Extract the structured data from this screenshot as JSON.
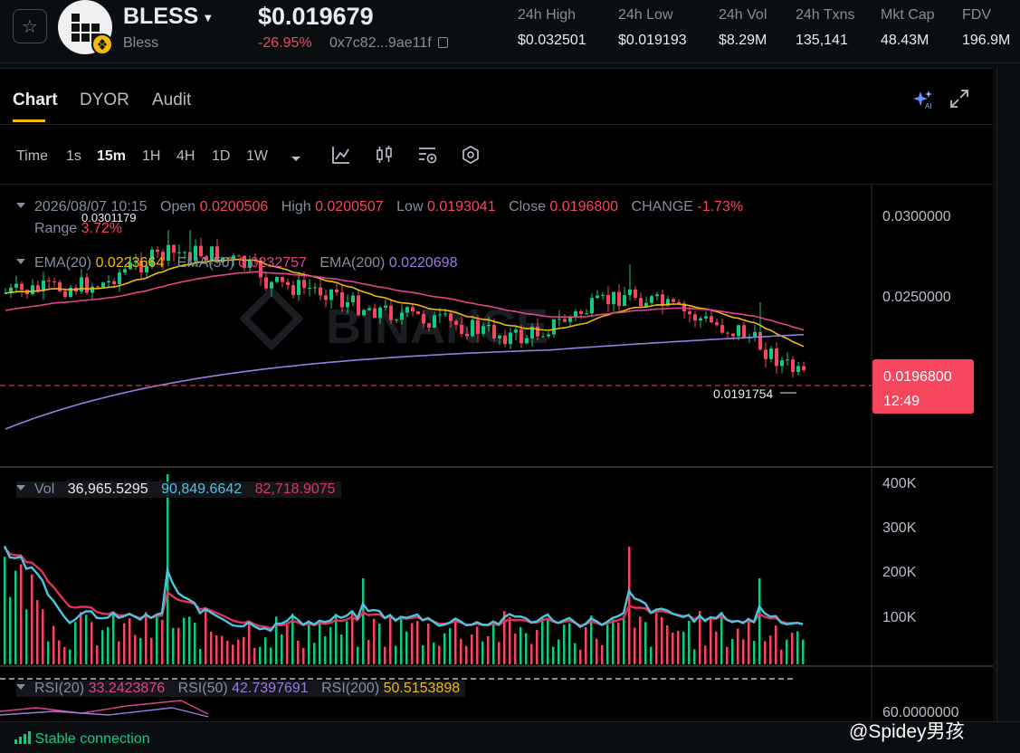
{
  "token": {
    "symbol": "BLESS",
    "name": "Bless",
    "price": "$0.019679",
    "change": "-26.95%",
    "address": "0x7c82...9ae11f"
  },
  "stats": [
    {
      "label": "24h High",
      "value": "$0.032501"
    },
    {
      "label": "24h Low",
      "value": "$0.019193"
    },
    {
      "label": "24h Vol",
      "value": "$8.29M"
    },
    {
      "label": "24h Txns",
      "value": "135,141"
    },
    {
      "label": "Mkt Cap",
      "value": "48.43M"
    },
    {
      "label": "FDV",
      "value": "196.9M"
    }
  ],
  "tabs": [
    "Chart",
    "DYOR",
    "Audit"
  ],
  "timeframes": [
    "Time",
    "1s",
    "15m",
    "1H",
    "4H",
    "1D",
    "1W"
  ],
  "active_timeframe": "15m",
  "ohlc": {
    "date": "2026/08/07 10:15",
    "open_label": "Open",
    "open": "0.0200506",
    "high_label": "High",
    "high": "0.0200507",
    "low_label": "Low",
    "low": "0.0193041",
    "close_label": "Close",
    "close": "0.0196800",
    "change_label": "CHANGE",
    "change": "-1.73%",
    "range_label": "Range",
    "range": "3.72%"
  },
  "ema": {
    "ema20_label": "EMA(20)",
    "ema20": "0.0223664",
    "ema50_label": "EMA(50)",
    "ema50": "0.0232757",
    "ema200_label": "EMA(200)",
    "ema200": "0.0220698"
  },
  "volume": {
    "label": "Vol",
    "v1": "36,965.5295",
    "v2": "90,849.6642",
    "v3": "82,718.9075"
  },
  "rsi": {
    "rsi20_label": "RSI(20)",
    "rsi20": "33.2423876",
    "rsi50_label": "RSI(50)",
    "rsi50": "42.7397691",
    "rsi200_label": "RSI(200)",
    "rsi200": "50.5153898"
  },
  "price_axis": [
    "0.0300000",
    "0.0250000"
  ],
  "vol_axis": [
    "400K",
    "300K",
    "200K",
    "100K"
  ],
  "rsi_axis": [
    "60.0000000"
  ],
  "current_price": "0.0196800",
  "countdown": "12:49",
  "low_marker": "0.0191754",
  "high_marker": "0.0301179",
  "watermark": "BINANCE",
  "status": "Stable connection",
  "footer_watermark": "@Spidey男孩",
  "colors": {
    "up": "#0ecb81",
    "down": "#f6465d",
    "accent": "#f0b90b",
    "ema20": "#f0b90b",
    "ema50": "#e0448c",
    "ema200": "#9b7be0",
    "vol_ma1": "#4dc4e0",
    "vol_ma2": "#e0335a"
  }
}
